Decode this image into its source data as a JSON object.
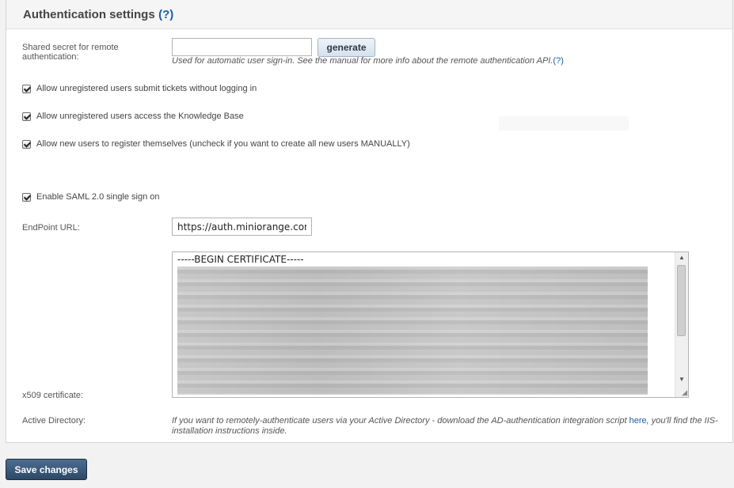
{
  "header": {
    "title": "Authentication settings",
    "help": "(?)"
  },
  "shared_secret": {
    "label": "Shared secret for remote authentication:",
    "value": "",
    "generate_label": "generate",
    "hint": "Used for automatic user sign-in. See the manual for more info about the remote authentication API.",
    "hint_help": "(?)"
  },
  "options": {
    "allow_tickets": {
      "label": "Allow unregistered users submit tickets without logging in",
      "checked": true
    },
    "allow_kb": {
      "label": "Allow unregistered users access the Knowledge Base",
      "checked": true
    },
    "allow_register": {
      "label": "Allow new users to register themselves (uncheck if you want to create all new users MANUALLY)",
      "checked": true
    },
    "enable_saml": {
      "label": "Enable SAML 2.0 single sign on",
      "checked": true
    }
  },
  "endpoint": {
    "label": "EndPoint URL:",
    "value": "https://auth.miniorange.com/moas/idp/samlsso"
  },
  "certificate": {
    "label": "x509 certificate:",
    "header_line": "-----BEGIN CERTIFICATE-----"
  },
  "active_directory": {
    "label": "Active Directory:",
    "text_before": "If you want to remotely-authenticate users via your Active Directory - download the AD-authentication integration script ",
    "link": "here",
    "text_after": ", you'll find the IIS-installation instructions inside."
  },
  "footer": {
    "save_label": "Save changes"
  },
  "colors": {
    "link": "#1a5fa6",
    "save_button": "#2c4866"
  }
}
